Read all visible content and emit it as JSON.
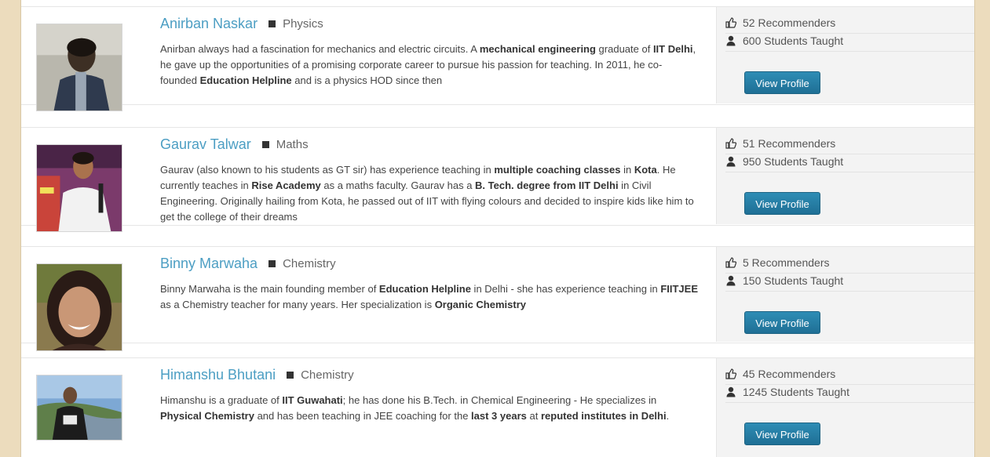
{
  "view_profile_label": "View Profile",
  "teachers": [
    {
      "name": "Anirban Naskar",
      "subject": "Physics",
      "bio": [
        {
          "t": "Anirban always had a fascination for mechanics and electric circuits. A ",
          "b": false
        },
        {
          "t": "mechanical engineering",
          "b": true
        },
        {
          "t": " graduate of ",
          "b": false
        },
        {
          "t": "IIT Delhi",
          "b": true
        },
        {
          "t": ", he gave up the opportunities of a promising corporate career to pursue his passion for teaching. In 2011, he co-founded ",
          "b": false
        },
        {
          "t": "Education Helpline",
          "b": true
        },
        {
          "t": " and is a physics HOD since then",
          "b": false
        }
      ],
      "recommenders": "52 Recommenders",
      "students": "600 Students Taught"
    },
    {
      "name": "Gaurav Talwar",
      "subject": "Maths",
      "bio": [
        {
          "t": "Gaurav (also known to his students as GT sir) has experience teaching in ",
          "b": false
        },
        {
          "t": "multiple coaching classes",
          "b": true
        },
        {
          "t": " in ",
          "b": false
        },
        {
          "t": "Kota",
          "b": true
        },
        {
          "t": ". He currently teaches in ",
          "b": false
        },
        {
          "t": "Rise Academy",
          "b": true
        },
        {
          "t": " as a maths faculty. Gaurav has a ",
          "b": false
        },
        {
          "t": "B. Tech. degree from IIT Delhi",
          "b": true
        },
        {
          "t": " in Civil Engineering. Originally hailing from Kota, he passed out of IIT with flying colours and decided to inspire kids like him to get the college of their dreams",
          "b": false
        }
      ],
      "recommenders": "51 Recommenders",
      "students": "950 Students Taught"
    },
    {
      "name": "Binny Marwaha",
      "subject": "Chemistry",
      "bio": [
        {
          "t": "Binny Marwaha is the main founding member of ",
          "b": false
        },
        {
          "t": "Education Helpline",
          "b": true
        },
        {
          "t": " in Delhi - she has experience teaching in ",
          "b": false
        },
        {
          "t": "FIITJEE",
          "b": true
        },
        {
          "t": " as a Chemistry teacher for many years. Her specialization is ",
          "b": false
        },
        {
          "t": "Organic Chemistry",
          "b": true
        }
      ],
      "recommenders": "5 Recommenders",
      "students": "150 Students Taught"
    },
    {
      "name": "Himanshu Bhutani",
      "subject": "Chemistry",
      "bio": [
        {
          "t": "Himanshu is a graduate of ",
          "b": false
        },
        {
          "t": "IIT Guwahati",
          "b": true
        },
        {
          "t": "; he has done his B.Tech. in Chemical Engineering - He specializes in ",
          "b": false
        },
        {
          "t": "Physical Chemistry",
          "b": true
        },
        {
          "t": " and has been teaching in JEE coaching for the ",
          "b": false
        },
        {
          "t": "last 3 years",
          "b": true
        },
        {
          "t": " at ",
          "b": false
        },
        {
          "t": "reputed institutes in Delhi",
          "b": true
        },
        {
          "t": ".",
          "b": false
        }
      ],
      "recommenders": "45 Recommenders",
      "students": "1245 Students Taught"
    }
  ],
  "icons": {
    "recommend": "thumbs-up-icon",
    "students": "user-icon"
  },
  "colors": {
    "name": "#4c9ec3",
    "button": "#2179a3",
    "background": "#ecdcbd"
  }
}
